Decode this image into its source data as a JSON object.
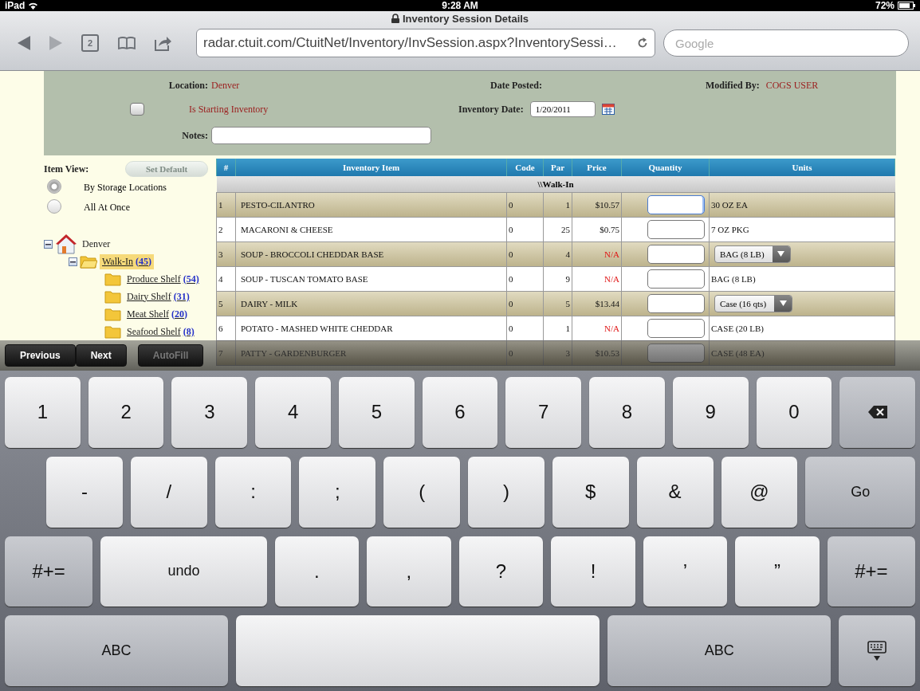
{
  "status_bar": {
    "device": "iPad",
    "time": "9:28 AM",
    "battery": "72%"
  },
  "browser": {
    "title": "Inventory Session Details",
    "tab_count": "2",
    "url": "radar.ctuit.com/CtuitNet/Inventory/InvSession.aspx?InventorySessi…",
    "search_placeholder": "Google",
    "forward_disabled": true
  },
  "header": {
    "location_label": "Location:",
    "location": "Denver",
    "date_posted_label": "Date Posted:",
    "modified_by_label": "Modified By:",
    "modified_by": "COGS USER",
    "starting_checkbox": {
      "label": "Is Starting Inventory",
      "checked": false
    },
    "inventory_date_label": "Inventory Date:",
    "inventory_date": "1/20/2011",
    "notes_label": "Notes:"
  },
  "item_view": {
    "label": "Item View:",
    "button": {
      "label": "Set Default",
      "disabled": true
    },
    "options": [
      {
        "label": "By Storage Locations",
        "selected": true
      },
      {
        "label": "All At Once",
        "selected": false
      }
    ]
  },
  "tree": [
    {
      "label": "Denver",
      "kind": "location",
      "expanded": true,
      "selected": false,
      "children": [
        {
          "label": "Walk-In",
          "count": "(45)",
          "kind": "folder",
          "expanded": true,
          "selected": true,
          "children": [
            {
              "label": "Produce Shelf",
              "count": "(54)",
              "kind": "folder",
              "selected": false
            },
            {
              "label": "Dairy Shelf",
              "count": "(31)",
              "kind": "folder",
              "selected": false
            },
            {
              "label": "Meat Shelf",
              "count": "(20)",
              "kind": "folder",
              "selected": false
            },
            {
              "label": "Seafood Shelf",
              "count": "(8)",
              "kind": "folder",
              "selected": false
            }
          ]
        }
      ]
    }
  ],
  "table": {
    "columns": [
      "#",
      "Inventory Item",
      "Code",
      "Par",
      "Price",
      "Quantity",
      "Units"
    ],
    "group": "\\\\Walk-In",
    "rows": [
      {
        "number": "1",
        "item": "PESTO-CILANTRO",
        "code": "0",
        "par": "1",
        "price": "$10.57",
        "price_missing": false,
        "focused": true,
        "units": {
          "kind": "text",
          "label": "30 OZ EA"
        }
      },
      {
        "number": "2",
        "item": "MACARONI & CHEESE",
        "code": "0",
        "par": "25",
        "price": "$0.75",
        "price_missing": false,
        "focused": false,
        "units": {
          "kind": "text",
          "label": "7 OZ PKG"
        }
      },
      {
        "number": "3",
        "item": "SOUP - BROCCOLI CHEDDAR BASE",
        "code": "0",
        "par": "4",
        "price": "N/A",
        "price_missing": true,
        "focused": false,
        "units": {
          "kind": "select",
          "label": "BAG (8 LB)"
        }
      },
      {
        "number": "4",
        "item": "SOUP - TUSCAN TOMATO BASE",
        "code": "0",
        "par": "9",
        "price": "N/A",
        "price_missing": true,
        "focused": false,
        "units": {
          "kind": "text",
          "label": "BAG (8 LB)"
        }
      },
      {
        "number": "5",
        "item": "DAIRY - MILK",
        "code": "0",
        "par": "5",
        "price": "$13.44",
        "price_missing": false,
        "focused": false,
        "units": {
          "kind": "select",
          "label": "Case (16 qts)"
        }
      },
      {
        "number": "6",
        "item": "POTATO - MASHED WHITE CHEDDAR",
        "code": "0",
        "par": "1",
        "price": "N/A",
        "price_missing": true,
        "focused": false,
        "units": {
          "kind": "text",
          "label": "CASE (20 LB)"
        }
      },
      {
        "number": "7",
        "item": "PATTY - GARDENBURGER",
        "code": "0",
        "par": "3",
        "price": "$10.53",
        "price_missing": false,
        "focused": false,
        "units": {
          "kind": "text",
          "label": "CASE (48 EA)"
        }
      }
    ]
  },
  "form_bar": {
    "buttons": [
      {
        "label": "Previous",
        "disabled": false
      },
      {
        "label": "Next",
        "disabled": false
      },
      {
        "label": "AutoFill",
        "disabled": true
      }
    ]
  },
  "keyboard": {
    "rows": [
      [
        {
          "kind": "char",
          "label": "1"
        },
        {
          "kind": "char",
          "label": "2"
        },
        {
          "kind": "char",
          "label": "3"
        },
        {
          "kind": "char",
          "label": "4"
        },
        {
          "kind": "char",
          "label": "5"
        },
        {
          "kind": "char",
          "label": "6"
        },
        {
          "kind": "char",
          "label": "7"
        },
        {
          "kind": "char",
          "label": "8"
        },
        {
          "kind": "char",
          "label": "9"
        },
        {
          "kind": "char",
          "label": "0"
        },
        {
          "kind": "backspace"
        }
      ],
      [
        {
          "kind": "char",
          "label": "-"
        },
        {
          "kind": "char",
          "label": "/"
        },
        {
          "kind": "char",
          "label": ":"
        },
        {
          "kind": "char",
          "label": ";"
        },
        {
          "kind": "char",
          "label": "("
        },
        {
          "kind": "char",
          "label": ")"
        },
        {
          "kind": "char",
          "label": "$"
        },
        {
          "kind": "char",
          "label": "&"
        },
        {
          "kind": "char",
          "label": "@"
        },
        {
          "kind": "go",
          "label": "Go"
        }
      ],
      [
        {
          "kind": "shift",
          "label": "#+="
        },
        {
          "kind": "undo",
          "label": "undo"
        },
        {
          "kind": "char",
          "label": "."
        },
        {
          "kind": "char",
          "label": ","
        },
        {
          "kind": "char",
          "label": "?"
        },
        {
          "kind": "char",
          "label": "!"
        },
        {
          "kind": "char",
          "label": "’"
        },
        {
          "kind": "char",
          "label": "”"
        },
        {
          "kind": "shift",
          "label": "#+="
        }
      ],
      [
        {
          "kind": "abc",
          "label": "ABC"
        },
        {
          "kind": "space"
        },
        {
          "kind": "abc",
          "label": "ABC"
        },
        {
          "kind": "hide"
        }
      ]
    ]
  }
}
